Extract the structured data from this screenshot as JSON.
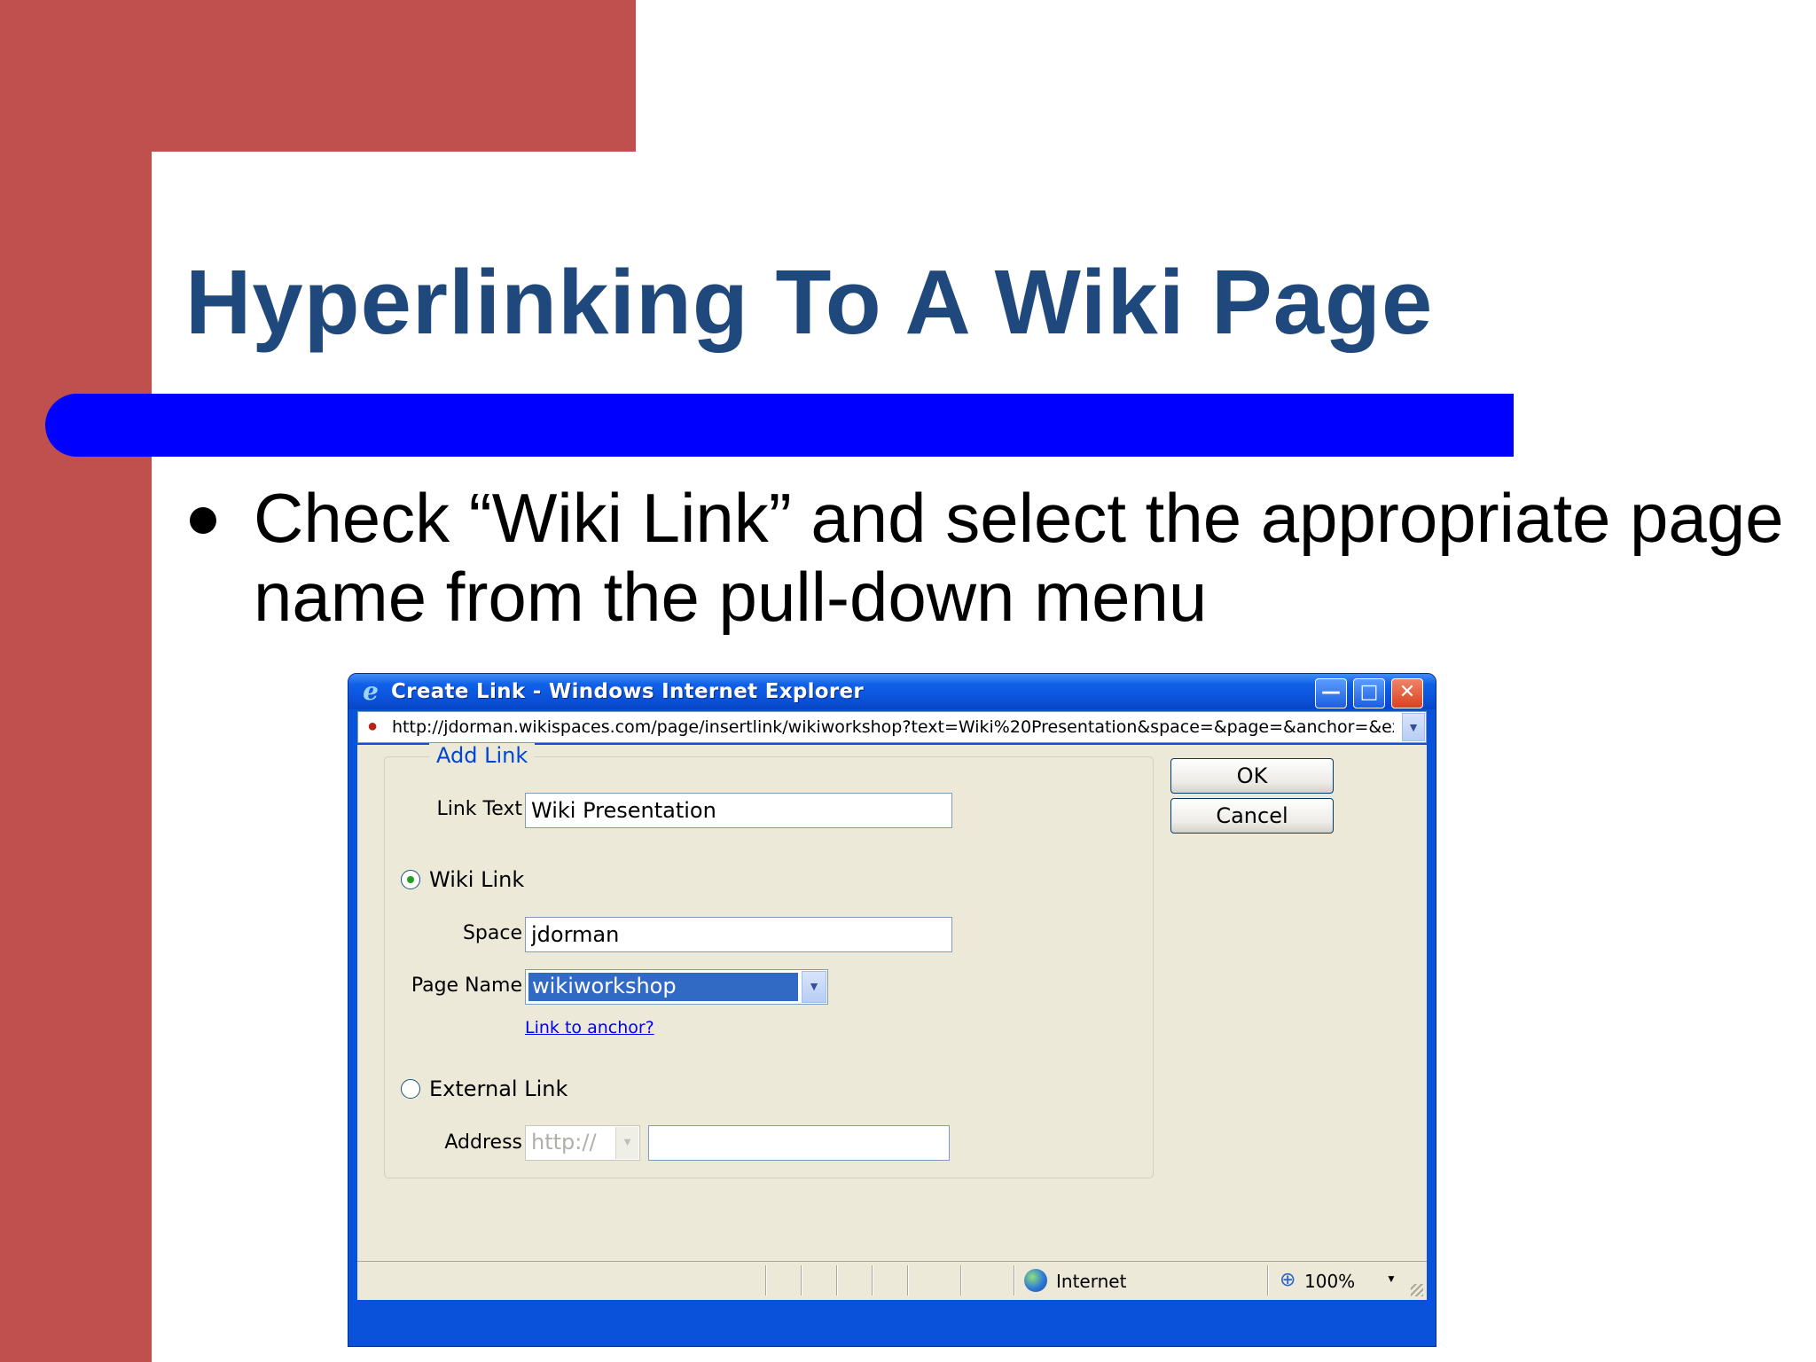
{
  "slide": {
    "title": "Hyperlinking To A Wiki Page",
    "bullet": "Check “Wiki Link” and select the appropriate page name from the pull-down menu"
  },
  "window": {
    "title": "Create Link - Windows Internet Explorer",
    "url": "http://jdorman.wikispaces.com/page/insertlink/wikiworkshop?text=Wiki%20Presentation&space=&page=&anchor=&extLink",
    "icons": {
      "app": "internet-explorer-icon",
      "page": "wikispaces-page-icon",
      "zone": "globe-icon",
      "zoom": "zoom-magnifier-icon"
    }
  },
  "form": {
    "legend": "Add Link",
    "link_text_label": "Link Text",
    "link_text_value": "Wiki Presentation",
    "wiki_link_label": "Wiki Link",
    "wiki_link_selected": true,
    "space_label": "Space",
    "space_value": "jdorman",
    "page_name_label": "Page Name",
    "page_name_value": "wikiworkshop",
    "anchor_link": "Link to anchor?",
    "external_link_label": "External Link",
    "external_link_selected": false,
    "address_label": "Address",
    "address_protocol": "http://",
    "address_value": ""
  },
  "buttons": {
    "ok": "OK",
    "cancel": "Cancel"
  },
  "status": {
    "zone": "Internet",
    "zoom": "100%"
  },
  "colors": {
    "slide_red": "#c0504d",
    "title_blue": "#1f497d",
    "bar_blue": "#0000ff",
    "xp_titlebar": "#0a52d9",
    "dialog_bg": "#ece9d8",
    "selection": "#316ac5",
    "legend_blue": "#0046d5"
  }
}
